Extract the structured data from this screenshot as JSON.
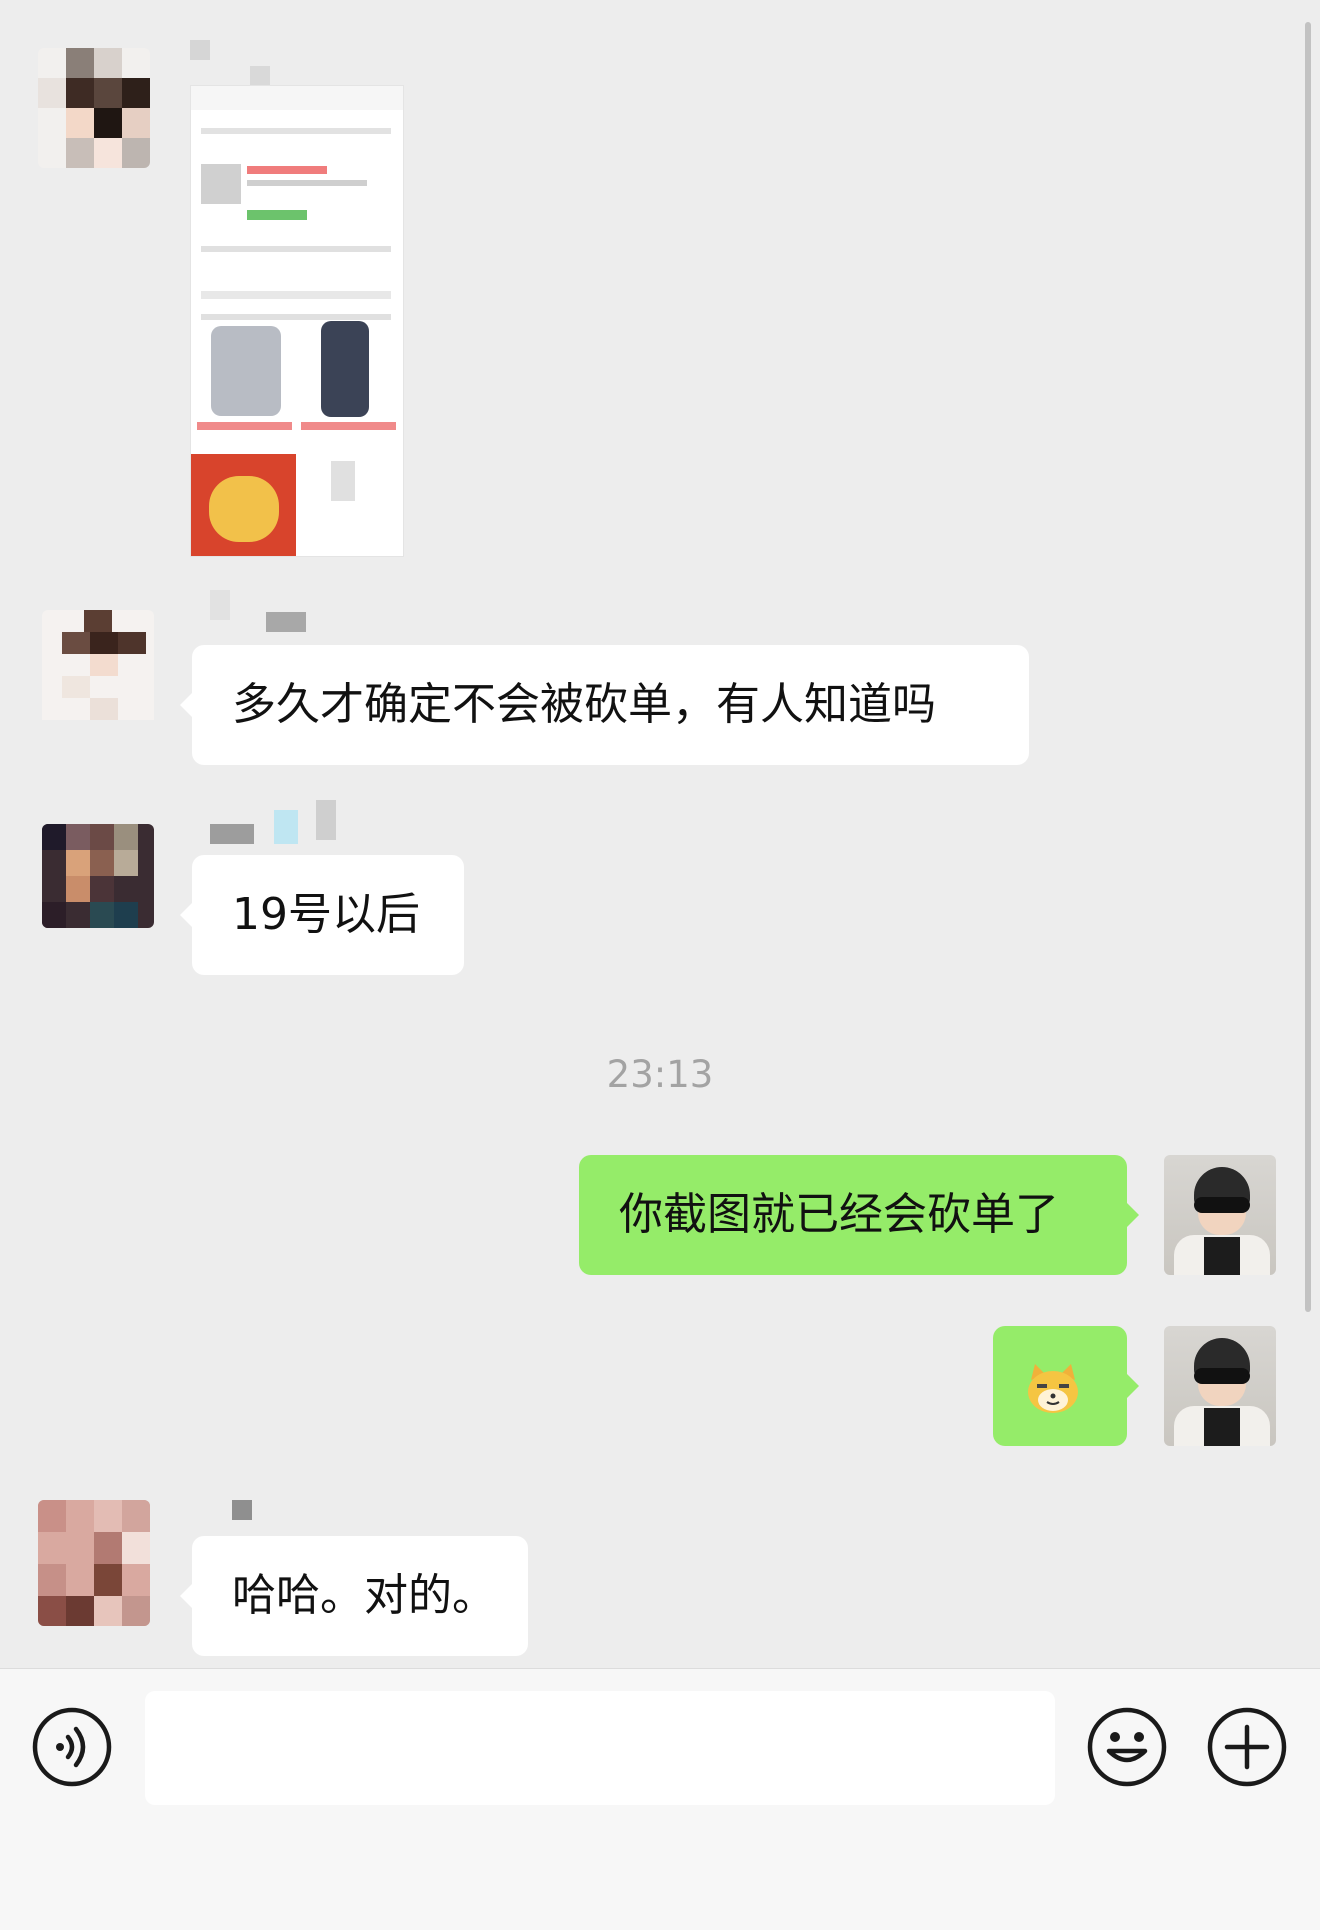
{
  "messages": [
    {
      "type": "image",
      "direction": "incoming"
    },
    {
      "type": "text",
      "direction": "incoming",
      "text": "多久才确定不会被砍单，有人知道吗"
    },
    {
      "type": "text",
      "direction": "incoming",
      "text": "19号以后"
    },
    {
      "type": "timestamp",
      "text": "23:13"
    },
    {
      "type": "text",
      "direction": "outgoing",
      "text": "你截图就已经会砍单了"
    },
    {
      "type": "sticker",
      "direction": "outgoing",
      "icon": "doge-emoji-icon"
    },
    {
      "type": "text",
      "direction": "incoming",
      "text": "哈哈。对的。"
    }
  ],
  "input_bar": {
    "voice_icon": "voice-icon",
    "text_value": "",
    "emoji_icon": "smiley-icon",
    "more_icon": "plus-icon"
  },
  "colors": {
    "background": "#ededed",
    "incoming_bubble": "#ffffff",
    "outgoing_bubble": "#95ec69",
    "timestamp_text": "#a3a3a3"
  }
}
